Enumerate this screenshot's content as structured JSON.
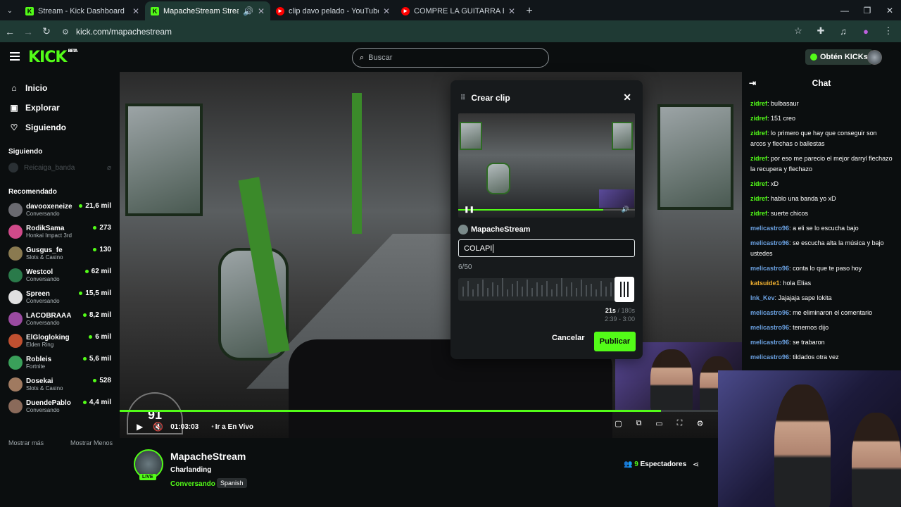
{
  "browser": {
    "tabs": [
      {
        "title": "Stream - Kick Dashboard",
        "favicon": "kick-icon",
        "active": false
      },
      {
        "title": "MapacheStream Stream - W",
        "favicon": "kick-icon",
        "active": true
      },
      {
        "title": "clip davo pelado - YouTube",
        "favicon": "youtube-icon",
        "active": false
      },
      {
        "title": "COMPRE LA GUITARRA ELÉCTR",
        "favicon": "youtube-icon",
        "active": false
      }
    ],
    "url": "kick.com/mapachestream"
  },
  "header": {
    "logo": "KICK",
    "logo_badge": "BETA",
    "search_placeholder": "Buscar",
    "kicks_button": "Obtén KICKs"
  },
  "sidebar": {
    "nav": [
      {
        "label": "Inicio",
        "icon": "home-icon"
      },
      {
        "label": "Explorar",
        "icon": "compass-icon"
      },
      {
        "label": "Siguiendo",
        "icon": "heart-icon"
      }
    ],
    "following_title": "Siguiendo",
    "following": [
      {
        "name": "Reicaiga_banda"
      }
    ],
    "recommended_title": "Recomendado",
    "recommended": [
      {
        "name": "davooxeneize",
        "category": "Conversando",
        "viewers": "21,6 mil",
        "color": "#6a6a70"
      },
      {
        "name": "RodikSama",
        "category": "Honkai Impact 3rd",
        "viewers": "273",
        "color": "#d04a8a"
      },
      {
        "name": "Gusgus_fe",
        "category": "Slots & Casino",
        "viewers": "130",
        "color": "#8a7a50"
      },
      {
        "name": "Westcol",
        "category": "Conversando",
        "viewers": "62 mil",
        "color": "#2a7a4a"
      },
      {
        "name": "Spreen",
        "category": "Conversando",
        "viewers": "15,5 mil",
        "color": "#e0e0e0"
      },
      {
        "name": "LACOBRAAA",
        "category": "Conversando",
        "viewers": "8,2 mil",
        "color": "#9a4aa0"
      },
      {
        "name": "ElGlogloking",
        "category": "Elden Ring",
        "viewers": "6 mil",
        "color": "#c05030"
      },
      {
        "name": "Robleis",
        "category": "Fortnite",
        "viewers": "5,6 mil",
        "color": "#3aa05a"
      },
      {
        "name": "Dosekai",
        "category": "Slots & Casino",
        "viewers": "528",
        "color": "#a07a60"
      },
      {
        "name": "DuendePablo",
        "category": "Conversando",
        "viewers": "4,4 mil",
        "color": "#8a6a5a"
      }
    ],
    "show_more": "Mostrar más",
    "show_less": "Mostrar Menos"
  },
  "video": {
    "progress": 0.87,
    "time": "01:03:03",
    "live_label": "Ir a En Vivo",
    "speed": "91"
  },
  "clip_modal": {
    "title": "Crear clip",
    "channel": "MapacheStream",
    "input_value": "COLAPI",
    "char_count": "6/50",
    "duration": "21s",
    "max_duration": "180s",
    "range": "2:39 - 3:00",
    "cancel": "Cancelar",
    "publish": "Publicar"
  },
  "chat": {
    "title": "Chat",
    "messages": [
      {
        "user": "zidref",
        "text": "bulbasaur",
        "color": "#53fc18"
      },
      {
        "user": "zidref",
        "text": "151 creo",
        "color": "#53fc18"
      },
      {
        "user": "zidref",
        "text": "lo primero que hay que conseguir son arcos y flechas o ballestas",
        "color": "#53fc18"
      },
      {
        "user": "zidref",
        "text": "por eso me parecio el mejor darryl flechazo la recupera y flechazo",
        "color": "#53fc18"
      },
      {
        "user": "zidref",
        "text": "xD",
        "color": "#53fc18"
      },
      {
        "user": "zidref",
        "text": "hablo una banda yo xD",
        "color": "#53fc18"
      },
      {
        "user": "zidref",
        "text": "suerte chicos",
        "color": "#53fc18"
      },
      {
        "user": "melicastro96",
        "text": "a eli se lo escucha bajo",
        "color": "#6aa0e0"
      },
      {
        "user": "melicastro96",
        "text": "se escucha alta la música y bajo ustedes",
        "color": "#6aa0e0"
      },
      {
        "user": "melicastro96",
        "text": "conta lo que te paso hoy",
        "color": "#6aa0e0"
      },
      {
        "user": "katsuide1",
        "text": "hola Elías",
        "color": "#f0b030"
      },
      {
        "user": "lnk_Kev",
        "text": "Jajajaja sape lokita",
        "color": "#6aa0e0"
      },
      {
        "user": "melicastro96",
        "text": "me eliminaron el comentario",
        "color": "#6aa0e0"
      },
      {
        "user": "melicastro96",
        "text": "tenemos dijo",
        "color": "#6aa0e0"
      },
      {
        "user": "melicastro96",
        "text": "se trabaron",
        "color": "#6aa0e0"
      },
      {
        "user": "melicastro96",
        "text": "tildados otra vez",
        "color": "#6aa0e0"
      }
    ]
  },
  "stream_info": {
    "channel": "MapacheStream",
    "subtitle": "Charlanding",
    "category": "Conversando",
    "tag": "Spanish",
    "live": "LIVE",
    "viewers_count": "9",
    "viewers_label": "Espectadores"
  }
}
